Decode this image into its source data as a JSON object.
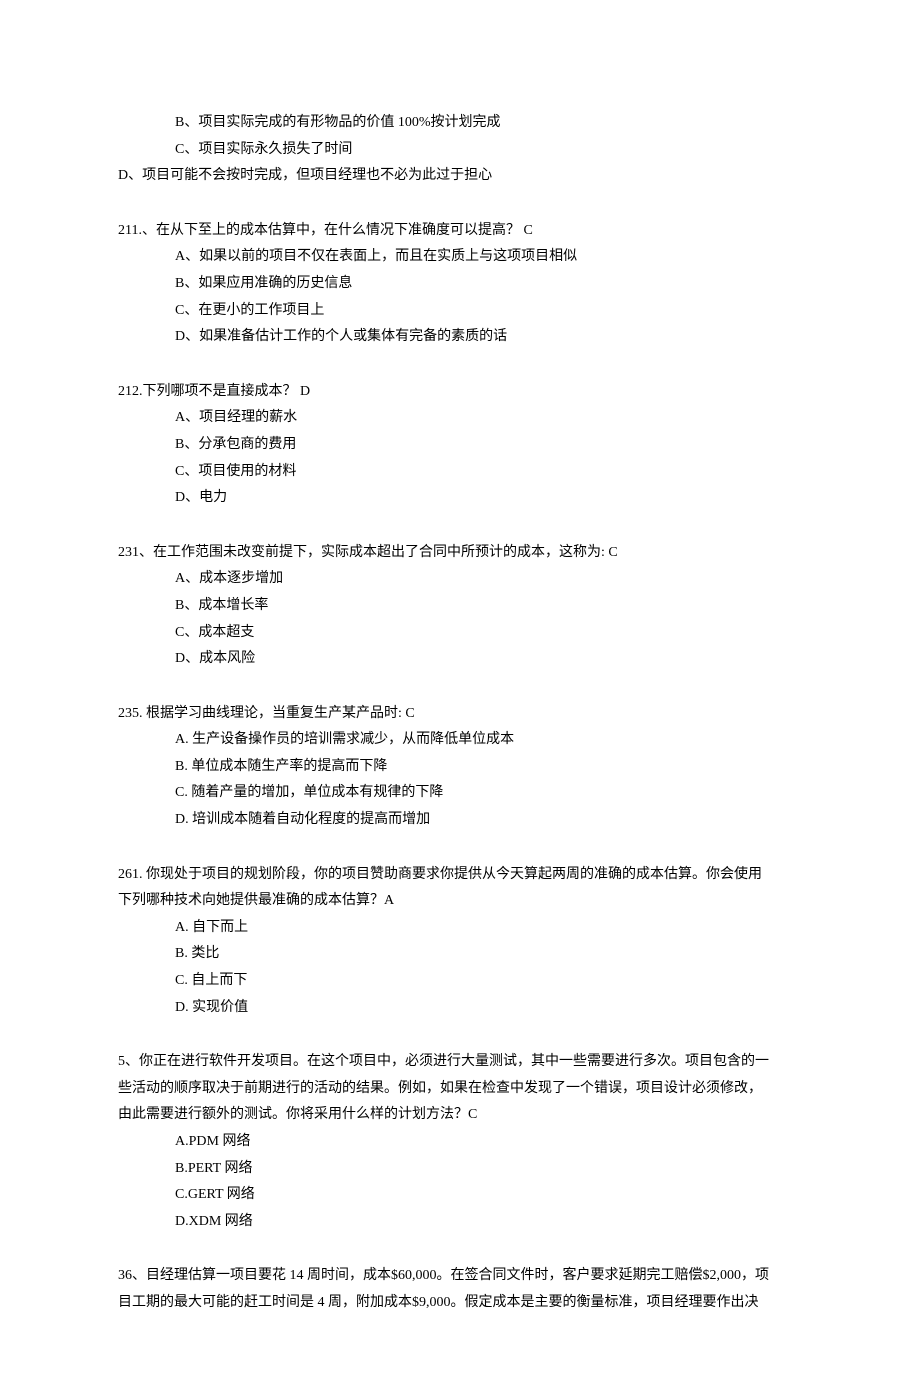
{
  "intro_options": {
    "b": "B、项目实际完成的有形物品的价值 100%按计划完成",
    "c": "C、项目实际永久损失了时间",
    "d": "D、项目可能不会按时完成，但项目经理也不必为此过于担心"
  },
  "q211": {
    "stem": "211.、在从下至上的成本估算中，在什么情况下准确度可以提高？  C",
    "a": "A、如果以前的项目不仅在表面上，而且在实质上与这项项目相似",
    "b": "B、如果应用准确的历史信息",
    "c": "C、在更小的工作项目上",
    "d": "D、如果准备估计工作的个人或集体有完备的素质的话"
  },
  "q212": {
    "stem": "212.下列哪项不是直接成本？  D",
    "a": "A、项目经理的薪水",
    "b": "B、分承包商的费用",
    "c": "C、项目使用的材料",
    "d": "D、电力"
  },
  "q231": {
    "stem": "231、在工作范围未改变前提下，实际成本超出了合同中所预计的成本，这称为: C",
    "a": "A、成本逐步增加",
    "b": "B、成本增长率",
    "c": "C、成本超支",
    "d": "D、成本风险"
  },
  "q235": {
    "stem": "235. 根据学习曲线理论，当重复生产某产品时:  C",
    "a": "A. 生产设备操作员的培训需求减少，从而降低单位成本",
    "b": "B. 单位成本随生产率的提高而下降",
    "c": "C. 随着产量的增加，单位成本有规律的下降",
    "d": "D. 培训成本随着自动化程度的提高而增加"
  },
  "q261": {
    "stem1": "261. 你现处于项目的规划阶段，你的项目赞助商要求你提供从今天算起两周的准确的成本估算。你会使用",
    "stem2": "下列哪种技术向她提供最准确的成本估算？A",
    "a": "A. 自下而上",
    "b": "B. 类比",
    "c": "C. 自上而下",
    "d": "D. 实现价值"
  },
  "q5": {
    "stem1": "5、你正在进行软件开发项目。在这个项目中，必须进行大量测试，其中一些需要进行多次。项目包含的一",
    "stem2": "些活动的顺序取决于前期进行的活动的结果。例如，如果在检查中发现了一个错误，项目设计必须修改，",
    "stem3": "由此需要进行额外的测试。你将采用什么样的计划方法？C",
    "a": "A.PDM 网络",
    "b": "B.PERT 网络",
    "c": "C.GERT 网络",
    "d": "D.XDM 网络"
  },
  "q36": {
    "stem1": "36、目经理估算一项目要花 14 周时间，成本$60,000。在签合同文件时，客户要求延期完工赔偿$2,000，项",
    "stem2": "目工期的最大可能的赶工时间是 4 周，附加成本$9,000。假定成本是主要的衡量标准，项目经理要作出决"
  }
}
